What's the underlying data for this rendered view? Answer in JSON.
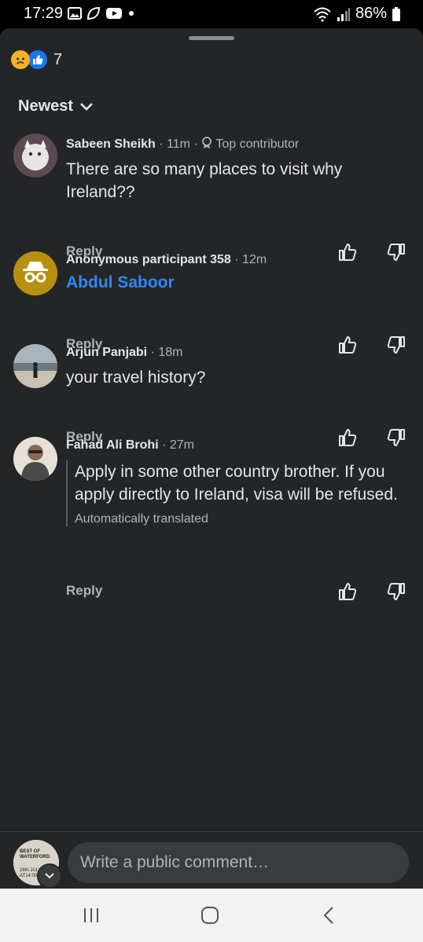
{
  "status": {
    "time": "17:29",
    "battery": "86%"
  },
  "reactions": {
    "count": "7"
  },
  "sort": {
    "label": "Newest"
  },
  "comments": [
    {
      "name": "Sabeen Sheikh",
      "time": "11m",
      "badge": "Top contributor",
      "text": "There are so many places to visit why Ireland??",
      "reply": "Reply"
    },
    {
      "name": "Anonymous participant 358",
      "time": "12m",
      "mention": "Abdul Saboor",
      "reply": "Reply"
    },
    {
      "name": "Arjun Panjabi",
      "time": "18m",
      "text": "your travel history?",
      "reply": "Reply"
    },
    {
      "name": "Fahad Ali Brohi",
      "time": "27m",
      "text": "Apply in some other country brother. If you apply directly to Ireland, visa will be refused.",
      "translated_label": "Automatically translated",
      "reply": "Reply"
    }
  ],
  "composer": {
    "placeholder": "Write a public comment…",
    "avatar_text": [
      "BEST OF",
      "WATERFORD",
      "26th JULY",
      "AT14:00"
    ]
  },
  "colors": {
    "sheet": "#242526",
    "accent": "#2d88ff",
    "secondary_text": "#b0b3b8"
  }
}
